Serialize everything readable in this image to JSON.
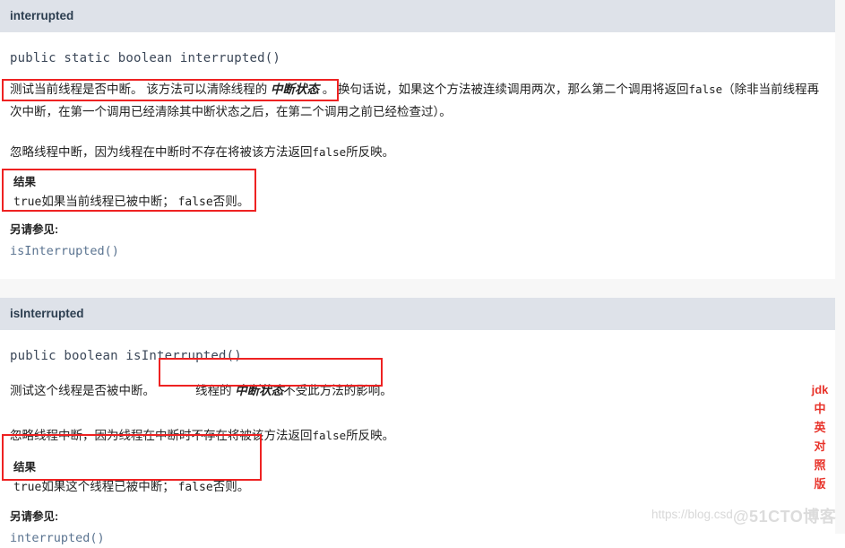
{
  "page": {
    "sections": [
      {
        "id": "interrupted",
        "header": "interrupted",
        "signature": "public static boolean interrupted()",
        "desc_part1": "测试当前线程是否中断。 该方法可以清除线程的 ",
        "desc_italic": "中断状态",
        "desc_part2": " 。",
        "desc_rest_a": " 换句话说，如果这个方法被连续调用两次，那么第二个调用将返回",
        "desc_rest_code": "false",
        "desc_rest_b": "（除非当前线程再次中断，在第一个调用已经清除其中断状态之后，在第二个调用之前已经检查过）。",
        "note_a": "忽略线程中断，因为线程在中断时不存在将被该方法返回",
        "note_code": "false",
        "note_b": "所反映。",
        "result_label": "结果",
        "result_code": "true",
        "result_mid": "如果当前线程已被中断；",
        "result_code2": "false",
        "result_end": "否则。",
        "see_label": "另请参见:",
        "see_link": "isInterrupted()"
      },
      {
        "id": "isInterrupted",
        "header": "isInterrupted",
        "signature": "public boolean isInterrupted()",
        "desc_lead": "测试这个线程是否被中断。",
        "desc_box_a": "线程的 ",
        "desc_box_italic": "中断状态",
        "desc_box_b": "不受此方法的影响。",
        "note_a": "忽略线程中断，因为线程在中断时不存在将被该方法返回",
        "note_code": "false",
        "note_b": "所反映。",
        "result_label": "结果",
        "result_code": "true",
        "result_mid": "如果这个线程已被中断；",
        "result_code2": "false",
        "result_end": "否则。",
        "see_label": "另请参见:",
        "see_link": "interrupted()"
      }
    ]
  },
  "brand": {
    "vertical_lines": [
      "jdk",
      "中",
      "英",
      "对",
      "照",
      "版"
    ],
    "color": "#e8332a"
  },
  "watermark": {
    "url": "https://blog.csd",
    "brand": "@51CTO博客"
  },
  "colors": {
    "header_bg": "#dee2e9",
    "header_text": "#2c3e50",
    "annotation_red": "#ee2222",
    "link": "#5a7390",
    "gutter": "#f7f7f7"
  }
}
